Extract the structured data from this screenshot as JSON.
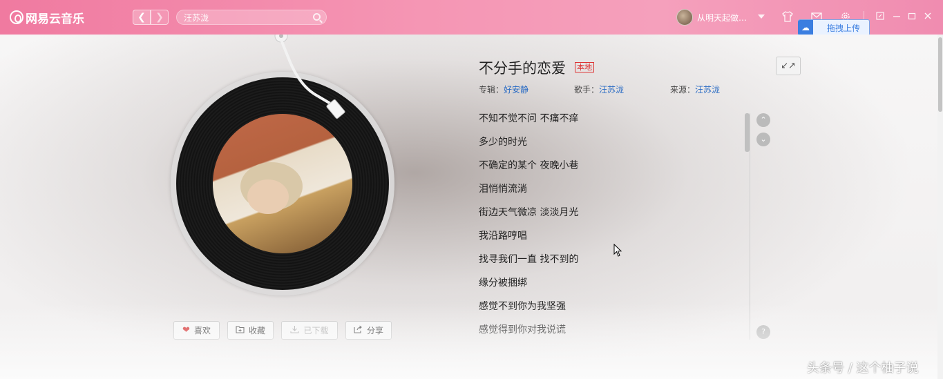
{
  "app": {
    "name": "网易云音乐"
  },
  "header": {
    "search_value": "汪苏泷",
    "username": "从明天起做…",
    "upload_tip": "拖拽上传"
  },
  "song": {
    "title": "不分手的恋爱",
    "badge": "本地",
    "album_label": "专辑：",
    "album": "好安静",
    "artist_label": "歌手：",
    "artist": "汪苏泷",
    "source_label": "来源：",
    "source": "汪苏泷"
  },
  "actions": {
    "like": "喜欢",
    "collect": "收藏",
    "downloaded": "已下载",
    "share": "分享"
  },
  "lyrics": [
    "不知不觉不问 不痛不痒",
    "多少的时光",
    "不确定的某个 夜晚小巷",
    "泪悄悄流淌",
    "街边天气微凉 淡淡月光",
    "我沿路哼唱",
    "找寻我们一直 找不到的",
    "缘分被捆绑",
    "感觉不到你为我坚强",
    "感觉得到你对我说谎"
  ],
  "watermark": "头条号 / 这个柚子说",
  "colors": {
    "titlebar": "#f596b4",
    "link": "#2b6cc4",
    "badge": "#dd3333",
    "heart": "#d52b2b"
  }
}
